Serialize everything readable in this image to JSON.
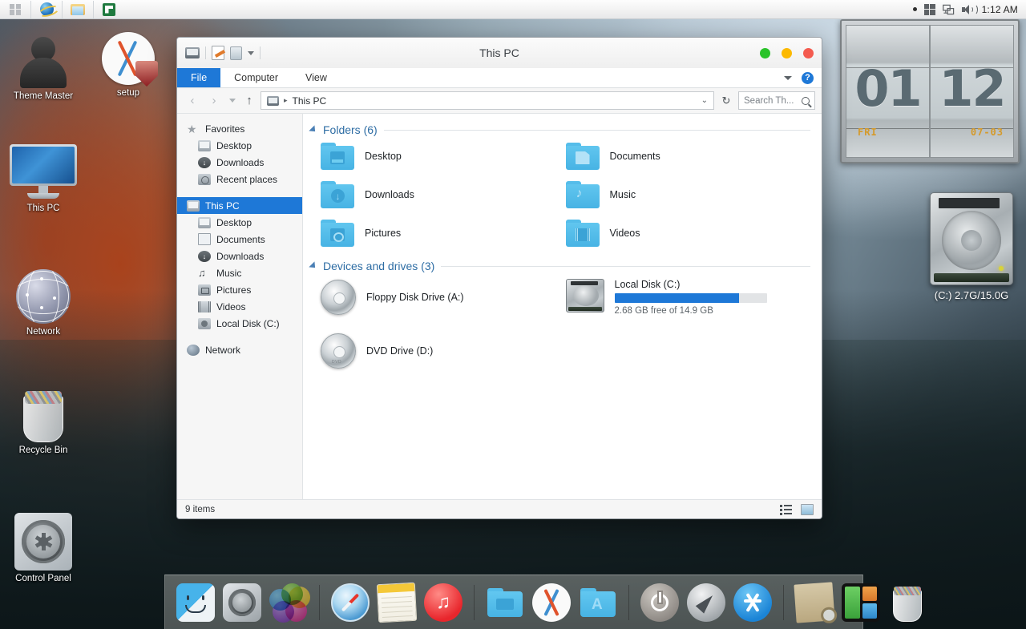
{
  "taskbar": {
    "left_items": [
      {
        "name": "start-button",
        "icon": "windows-logo-icon"
      },
      {
        "name": "internet-explorer",
        "icon": "internet-explorer-icon"
      },
      {
        "name": "file-explorer",
        "icon": "folder-explorer-icon"
      },
      {
        "name": "excel",
        "icon": "excel-icon"
      }
    ],
    "tray": {
      "overflow_icon": "overflow-dot-icon",
      "action_center_icon": "windows-grid-icon",
      "network_icon": "network-icon",
      "volume_icon": "speaker-icon",
      "clock": "1:12 AM"
    }
  },
  "desktop_icons": [
    {
      "label": "Theme Master",
      "icon": "user-silhouette-icon"
    },
    {
      "label": "setup",
      "icon": "osx-setup-shield-icon"
    },
    {
      "label": "This PC",
      "icon": "imac-computer-icon"
    },
    {
      "label": "Network",
      "icon": "network-globe-icon"
    },
    {
      "label": "Recycle Bin",
      "icon": "recycle-bin-full-icon"
    },
    {
      "label": "Control Panel",
      "icon": "control-panel-gear-icon"
    }
  ],
  "widgets": {
    "clock": {
      "hours": "01",
      "minutes": "12",
      "weekday": "FRI",
      "date": "07-03"
    },
    "disk": {
      "label": "(C:)  2.7G/15.0G"
    }
  },
  "explorer": {
    "title": "This PC",
    "quick_access": {
      "pc_icon": "this-pc-icon",
      "properties_icon": "properties-icon",
      "new_folder_icon": "new-folder-icon",
      "customize_icon": "customize-caret-icon"
    },
    "window_buttons": {
      "close_color": "#2ac32a",
      "minimize_color": "#fcb900",
      "maximize_color": "#f45b4f"
    },
    "ribbon_tabs": [
      {
        "label": "File",
        "active": true
      },
      {
        "label": "Computer",
        "active": false
      },
      {
        "label": "View",
        "active": false
      }
    ],
    "ribbon_right": {
      "expand_icon": "chevron-down-icon",
      "help_label": "?"
    },
    "address": {
      "back_glyph": "‹",
      "forward_glyph": "›",
      "recent_caret": "recent-locations-caret",
      "up_glyph": "↑",
      "breadcrumb_icon": "this-pc-icon",
      "breadcrumb": "This PC",
      "breadcrumb_sep": "▸",
      "dropdown_glyph": "⌄",
      "refresh_glyph": "↻"
    },
    "search": {
      "placeholder": "Search Th...",
      "icon": "search-icon"
    },
    "nav_pane": [
      {
        "label": "Favorites",
        "icon": "star-icon",
        "level": 0,
        "selected": false
      },
      {
        "label": "Desktop",
        "icon": "desktop-icon",
        "level": 1,
        "selected": false
      },
      {
        "label": "Downloads",
        "icon": "downloads-icon",
        "level": 1,
        "selected": false
      },
      {
        "label": "Recent places",
        "icon": "recent-places-icon",
        "level": 1,
        "selected": false
      },
      {
        "label": "This PC",
        "icon": "this-pc-icon",
        "level": 0,
        "selected": true
      },
      {
        "label": "Desktop",
        "icon": "desktop-icon",
        "level": 1,
        "selected": false
      },
      {
        "label": "Documents",
        "icon": "documents-icon",
        "level": 1,
        "selected": false
      },
      {
        "label": "Downloads",
        "icon": "downloads-icon",
        "level": 1,
        "selected": false
      },
      {
        "label": "Music",
        "icon": "music-icon",
        "level": 1,
        "selected": false
      },
      {
        "label": "Pictures",
        "icon": "pictures-icon",
        "level": 1,
        "selected": false
      },
      {
        "label": "Videos",
        "icon": "videos-icon",
        "level": 1,
        "selected": false
      },
      {
        "label": "Local Disk (C:)",
        "icon": "local-disk-icon",
        "level": 1,
        "selected": false
      },
      {
        "label": "Network",
        "icon": "network-globe-icon",
        "level": 0,
        "selected": false
      }
    ],
    "groups": {
      "folders": {
        "title": "Folders (6)",
        "items": [
          {
            "label": "Desktop",
            "icon": "folder-desktop-icon"
          },
          {
            "label": "Documents",
            "icon": "folder-documents-icon"
          },
          {
            "label": "Downloads",
            "icon": "folder-downloads-icon"
          },
          {
            "label": "Music",
            "icon": "folder-music-icon"
          },
          {
            "label": "Pictures",
            "icon": "folder-pictures-icon"
          },
          {
            "label": "Videos",
            "icon": "folder-videos-icon"
          }
        ]
      },
      "devices": {
        "title": "Devices and drives (3)",
        "items": [
          {
            "label": "Floppy Disk Drive (A:)",
            "icon": "disc-drive-icon",
            "kind": "disc"
          },
          {
            "label": "DVD Drive (D:)",
            "icon": "dvd-drive-icon",
            "kind": "disc",
            "tag": "DVD"
          },
          {
            "label": "Local Disk (C:)",
            "icon": "hard-disk-icon",
            "kind": "hdd",
            "capacity_text": "2.68 GB free of 14.9 GB",
            "used_percent": 82,
            "bar_color": "#1e78d7"
          }
        ]
      }
    },
    "status": {
      "items_text": "9 items",
      "details_view_icon": "details-view-icon",
      "large_icons_view_icon": "large-icons-view-icon"
    }
  },
  "dock": {
    "items": [
      {
        "name": "finder",
        "icon": "finder-icon"
      },
      {
        "name": "system-preferences",
        "icon": "system-preferences-gear-icon"
      },
      {
        "name": "color-wheel",
        "icon": "color-circles-icon"
      },
      {
        "name": "separator-1",
        "icon": "dock-separator"
      },
      {
        "name": "safari",
        "icon": "safari-compass-icon"
      },
      {
        "name": "notes",
        "icon": "notes-pad-icon"
      },
      {
        "name": "itunes",
        "icon": "itunes-music-icon"
      },
      {
        "name": "separator-2",
        "icon": "dock-separator"
      },
      {
        "name": "documents-folder",
        "icon": "blue-folder-icon"
      },
      {
        "name": "osx",
        "icon": "osx-x-icon"
      },
      {
        "name": "applications-folder",
        "icon": "applications-folder-icon"
      },
      {
        "name": "separator-3",
        "icon": "dock-separator"
      },
      {
        "name": "power",
        "icon": "power-icon"
      },
      {
        "name": "launchpad",
        "icon": "launchpad-rocket-icon"
      },
      {
        "name": "app-store",
        "icon": "app-store-icon"
      },
      {
        "name": "separator-4",
        "icon": "dock-separator"
      },
      {
        "name": "preview",
        "icon": "preview-photo-icon"
      },
      {
        "name": "mission-control",
        "icon": "mission-control-icon"
      },
      {
        "name": "trash",
        "icon": "trash-icon"
      }
    ]
  }
}
